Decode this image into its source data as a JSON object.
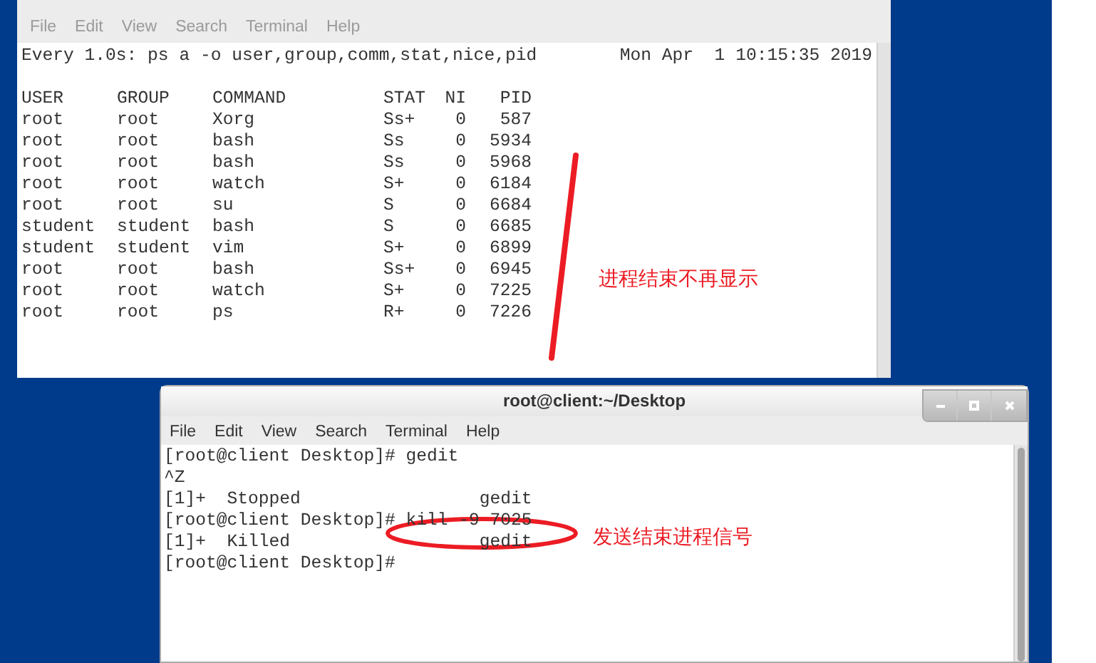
{
  "back_terminal": {
    "menu": [
      "File",
      "Edit",
      "View",
      "Search",
      "Terminal",
      "Help"
    ],
    "watch_header": "Every 1.0s: ps a -o user,group,comm,stat,nice,pid",
    "timestamp": "Mon Apr  1 10:15:35 2019",
    "table": {
      "columns": [
        "USER",
        "GROUP",
        "COMMAND",
        "STAT",
        "NI",
        "PID"
      ],
      "rows": [
        [
          "root",
          "root",
          "Xorg",
          "Ss+",
          "0",
          "587"
        ],
        [
          "root",
          "root",
          "bash",
          "Ss",
          "0",
          "5934"
        ],
        [
          "root",
          "root",
          "bash",
          "Ss",
          "0",
          "5968"
        ],
        [
          "root",
          "root",
          "watch",
          "S+",
          "0",
          "6184"
        ],
        [
          "root",
          "root",
          "su",
          "S",
          "0",
          "6684"
        ],
        [
          "student",
          "student",
          "bash",
          "S",
          "0",
          "6685"
        ],
        [
          "student",
          "student",
          "vim",
          "S+",
          "0",
          "6899"
        ],
        [
          "root",
          "root",
          "bash",
          "Ss+",
          "0",
          "6945"
        ],
        [
          "root",
          "root",
          "watch",
          "S+",
          "0",
          "7225"
        ],
        [
          "root",
          "root",
          "ps",
          "R+",
          "0",
          "7226"
        ]
      ]
    }
  },
  "front_terminal": {
    "title": "root@client:~/Desktop",
    "menu": [
      "File",
      "Edit",
      "View",
      "Search",
      "Terminal",
      "Help"
    ],
    "lines": [
      "[root@client Desktop]# gedit",
      "^Z",
      "[1]+  Stopped                 gedit",
      "[root@client Desktop]# kill -9 7025",
      "[1]+  Killed                  gedit",
      "[root@client Desktop]#"
    ]
  },
  "annotations": [
    {
      "text": "进程结束不再显示"
    },
    {
      "text": "发送结束进程信号"
    }
  ]
}
